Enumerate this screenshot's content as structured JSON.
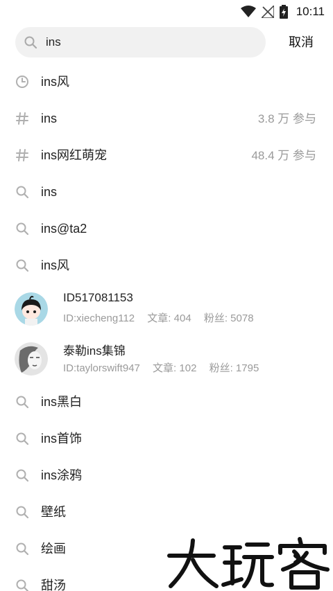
{
  "status_bar": {
    "time": "10:11",
    "icons": [
      "wifi-icon",
      "no-signal-icon",
      "battery-charging-icon"
    ]
  },
  "search": {
    "value": "ins",
    "cancel_label": "取消"
  },
  "history": [
    {
      "label": "ins风",
      "icon": "clock-icon"
    }
  ],
  "topics": [
    {
      "label": "ins",
      "meta": "3.8 万 参与",
      "icon": "hashtag-icon"
    },
    {
      "label": "ins网红萌宠",
      "meta": "48.4 万 参与",
      "icon": "hashtag-icon"
    }
  ],
  "suggestions_top": [
    {
      "label": "ins",
      "icon": "search-icon"
    },
    {
      "label": "ins@ta2",
      "icon": "search-icon"
    },
    {
      "label": "ins风",
      "icon": "search-icon"
    }
  ],
  "users": [
    {
      "name": "ID517081153",
      "id": "ID:xiecheng112",
      "articles": "文章: 404",
      "fans": "粉丝: 5078"
    },
    {
      "name": "泰勒ins集锦",
      "id": "ID:taylorswift947",
      "articles": "文章: 102",
      "fans": "粉丝: 1795"
    }
  ],
  "suggestions_bottom": [
    {
      "label": "ins黑白",
      "icon": "search-icon"
    },
    {
      "label": "ins首饰",
      "icon": "search-icon"
    },
    {
      "label": "ins涂鸦",
      "icon": "search-icon"
    },
    {
      "label": "壁纸",
      "icon": "search-icon"
    },
    {
      "label": "绘画",
      "icon": "search-icon"
    },
    {
      "label": "甜汤",
      "icon": "search-icon"
    }
  ],
  "watermark": {
    "text": "大玩客"
  },
  "colors": {
    "text": "#222222",
    "muted": "#9a9a9a",
    "search_bg": "#f1f1f1",
    "icon": "#b0b0b0"
  }
}
